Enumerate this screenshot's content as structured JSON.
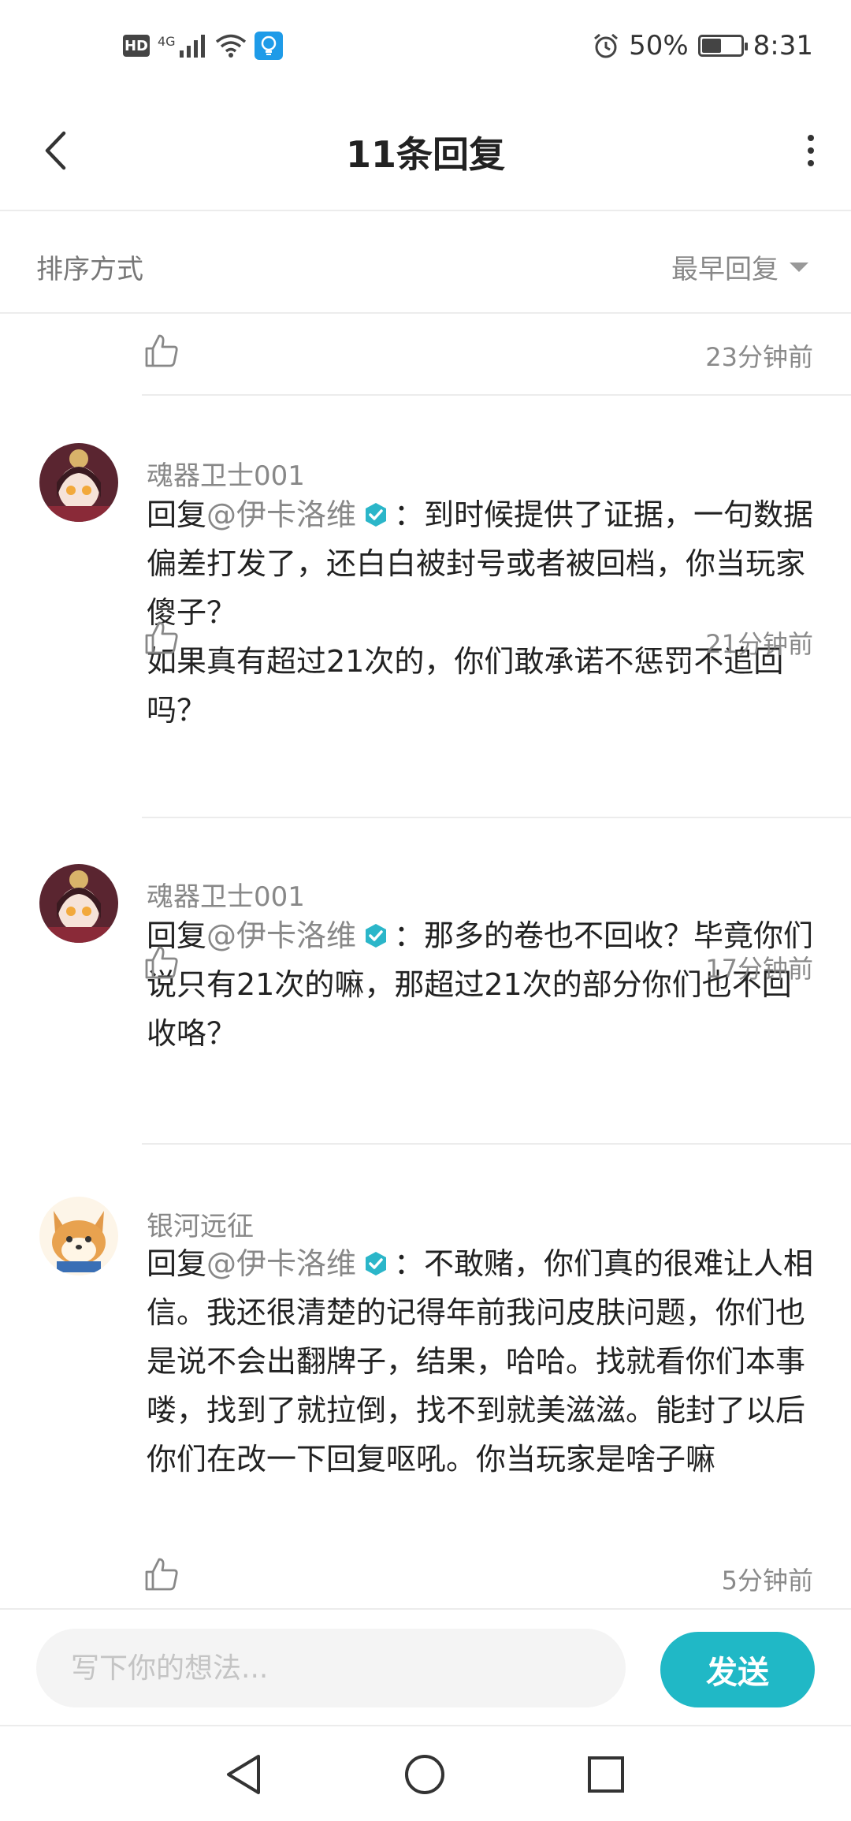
{
  "status_bar": {
    "hd": "HD",
    "network": "4G",
    "battery_text": "50%",
    "battery_level": 0.5,
    "time": "8:31"
  },
  "header": {
    "title": "11条回复"
  },
  "sort": {
    "label": "排序方式",
    "selected": "最早回复"
  },
  "comments": [
    {
      "time": "23分钟前"
    },
    {
      "username": "魂器卫士001",
      "reply_prefix": "回复",
      "mention": "@伊卡洛维",
      "text": "：到时候提供了证据，一句数据偏差打发了，还白白被封号或者被回档，你当玩家傻子？\n如果真有超过21次的，你们敢承诺不惩罚不追回吗？",
      "time": "21分钟前"
    },
    {
      "username": "魂器卫士001",
      "reply_prefix": "回复",
      "mention": "@伊卡洛维",
      "text": "：那多的卷也不回收？毕竟你们说只有21次的嘛，那超过21次的部分你们也不回收咯？",
      "time": "17分钟前"
    },
    {
      "username": "银河远征",
      "reply_prefix": "回复",
      "mention": "@伊卡洛维",
      "text": "：不敢赌，你们真的很难让人相信。我还很清楚的记得年前我问皮肤问题，你们也是说不会出翻牌子，结果，哈哈。找就看你们本事喽，找到了就拉倒，找不到就美滋滋。能封了以后你们在改一下回复呕吼。你当玩家是啥子嘛",
      "time": "5分钟前"
    }
  ],
  "input": {
    "placeholder": "写下你的想法..."
  },
  "send_button": "发送",
  "colors": {
    "accent": "#20b8c6",
    "verified": "#2bb6c9"
  }
}
